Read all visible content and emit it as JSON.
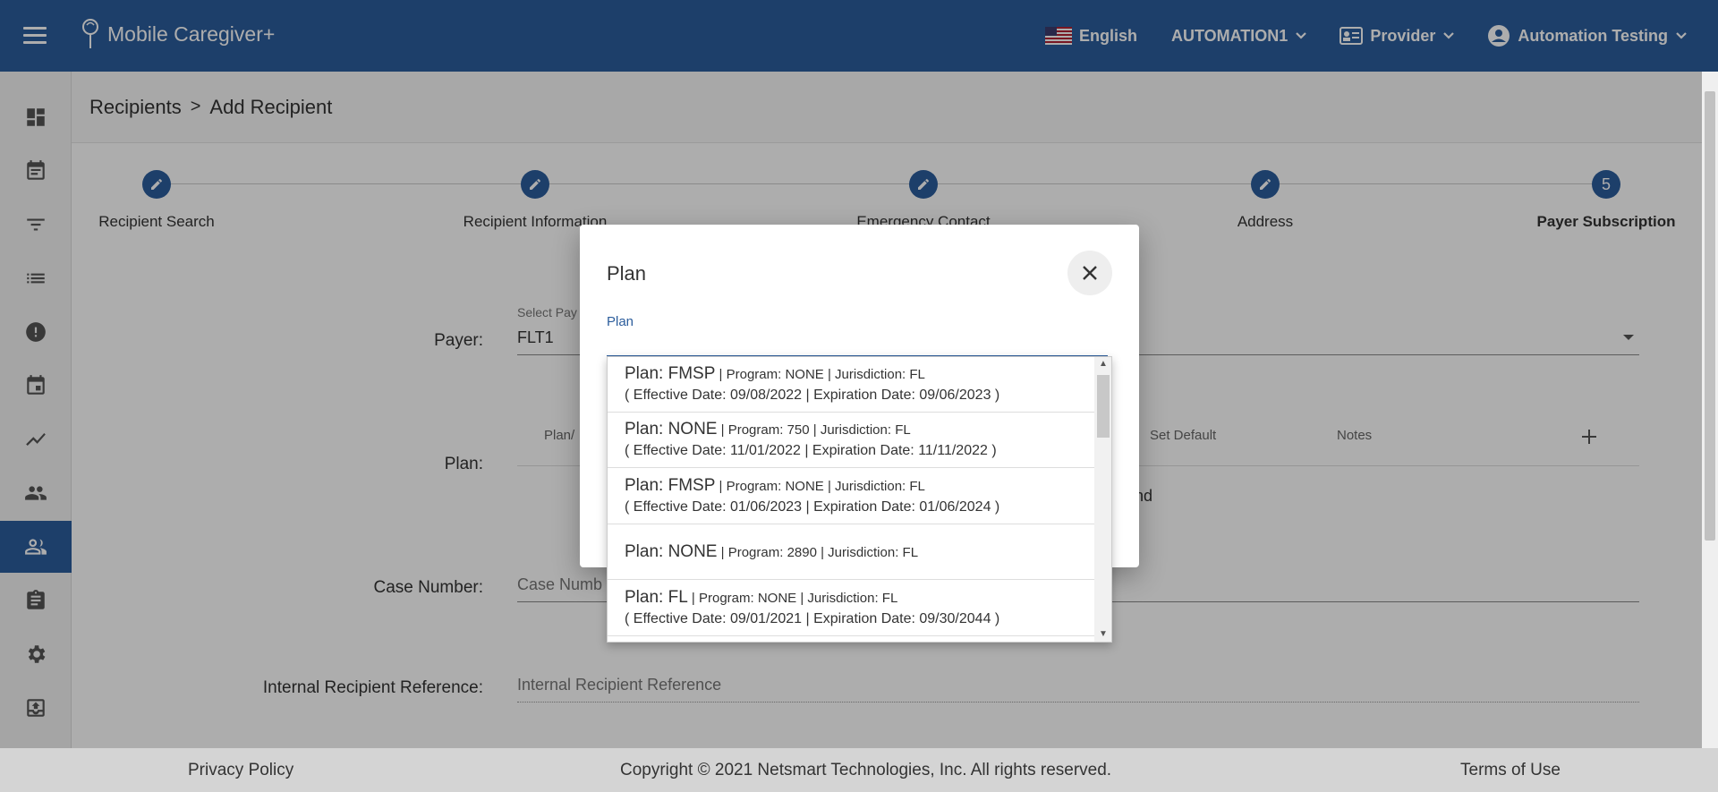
{
  "header": {
    "app_title": "Mobile Caregiver+",
    "language": "English",
    "agency": "AUTOMATION1",
    "role": "Provider",
    "user": "Automation Testing"
  },
  "sidebar": {
    "items": [
      {
        "name": "dashboard-icon"
      },
      {
        "name": "calendar-note-icon"
      },
      {
        "name": "filter-icon"
      },
      {
        "name": "list-icon"
      },
      {
        "name": "alert-icon"
      },
      {
        "name": "calendar-icon"
      },
      {
        "name": "trend-icon"
      },
      {
        "name": "people-icon"
      },
      {
        "name": "recipients-icon",
        "active": true
      },
      {
        "name": "clipboard-icon"
      },
      {
        "name": "settings-icon"
      },
      {
        "name": "upload-icon"
      }
    ]
  },
  "breadcrumb": {
    "parent": "Recipients",
    "separator": ">",
    "current": "Add Recipient"
  },
  "stepper": {
    "steps": [
      {
        "label": "Recipient Search",
        "state": "edit"
      },
      {
        "label": "Recipient Information",
        "state": "edit"
      },
      {
        "label": "Emergency Contact",
        "state": "edit"
      },
      {
        "label": "Address",
        "state": "edit"
      },
      {
        "label": "Payer Subscription",
        "state": "current",
        "number": "5"
      }
    ]
  },
  "form": {
    "payer_label": "Payer:",
    "payer_caption": "Select Pay",
    "payer_value": "FLT1",
    "plan_label": "Plan:",
    "plan_col_partial": "Plan/",
    "set_default_header": "Set Default",
    "notes_header": "Notes",
    "partial_text": "nd",
    "case_number_label": "Case Number:",
    "case_number_placeholder": "Case Numb",
    "internal_ref_label": "Internal Recipient Reference:",
    "internal_ref_placeholder": "Internal Recipient Reference"
  },
  "dialog": {
    "title": "Plan",
    "field_caption": "Plan",
    "field_value": ""
  },
  "plan_options": [
    {
      "plan": "Plan: FMSP",
      "meta": " | Program: NONE | Jurisdiction: FL",
      "dates": "( Effective Date: 09/08/2022 | Expiration Date: 09/06/2023 )"
    },
    {
      "plan": "Plan: NONE",
      "meta": " | Program: 750 | Jurisdiction: FL",
      "dates": "( Effective Date: 11/01/2022 | Expiration Date: 11/11/2022 )"
    },
    {
      "plan": "Plan: FMSP",
      "meta": " | Program: NONE | Jurisdiction: FL",
      "dates": "( Effective Date: 01/06/2023 | Expiration Date: 01/06/2024 )"
    },
    {
      "plan": "Plan: NONE",
      "meta": " | Program: 2890 | Jurisdiction: FL",
      "dates": ""
    },
    {
      "plan": "Plan: FL",
      "meta": " | Program: NONE | Jurisdiction: FL",
      "dates": "( Effective Date: 09/01/2021 | Expiration Date: 09/30/2044 )"
    }
  ],
  "footer": {
    "privacy": "Privacy Policy",
    "copyright": "Copyright © 2021 Netsmart Technologies, Inc. All rights reserved.",
    "terms": "Terms of Use"
  },
  "colors": {
    "primary": "#2c5d9c",
    "overlay": "rgba(0,0,0,0.32)"
  }
}
